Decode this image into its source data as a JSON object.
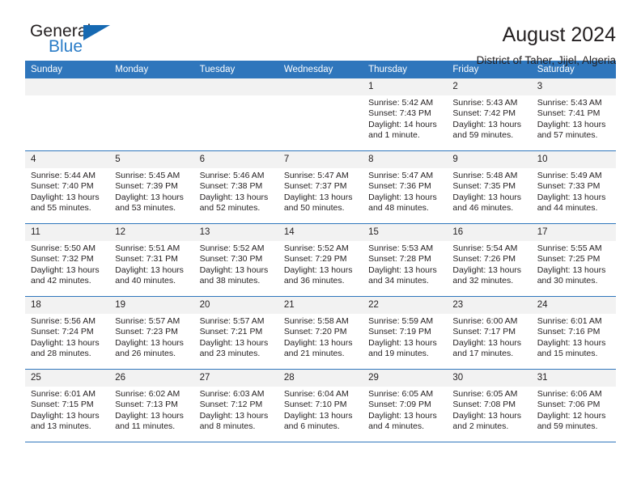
{
  "brand": {
    "name_part1": "General",
    "name_part2": "Blue",
    "triangle_color": "#1669b2",
    "blue_text_color": "#2a7cc7"
  },
  "header": {
    "title": "August 2024",
    "subtitle": "District of Taher, Jijel, Algeria"
  },
  "theme": {
    "header_bg": "#2f76bc",
    "daynum_bg": "#f2f2f2",
    "text": "#231f20"
  },
  "weekdays": [
    "Sunday",
    "Monday",
    "Tuesday",
    "Wednesday",
    "Thursday",
    "Friday",
    "Saturday"
  ],
  "labels": {
    "sunrise_prefix": "Sunrise:",
    "sunset_prefix": "Sunset:",
    "daylight_prefix": "Daylight:"
  },
  "weeks": [
    [
      {
        "day": "",
        "empty": true
      },
      {
        "day": "",
        "empty": true
      },
      {
        "day": "",
        "empty": true
      },
      {
        "day": "",
        "empty": true
      },
      {
        "day": "1",
        "sunrise": "Sunrise: 5:42 AM",
        "sunset": "Sunset: 7:43 PM",
        "daylight": "Daylight: 14 hours and 1 minute."
      },
      {
        "day": "2",
        "sunrise": "Sunrise: 5:43 AM",
        "sunset": "Sunset: 7:42 PM",
        "daylight": "Daylight: 13 hours and 59 minutes."
      },
      {
        "day": "3",
        "sunrise": "Sunrise: 5:43 AM",
        "sunset": "Sunset: 7:41 PM",
        "daylight": "Daylight: 13 hours and 57 minutes."
      }
    ],
    [
      {
        "day": "4",
        "sunrise": "Sunrise: 5:44 AM",
        "sunset": "Sunset: 7:40 PM",
        "daylight": "Daylight: 13 hours and 55 minutes."
      },
      {
        "day": "5",
        "sunrise": "Sunrise: 5:45 AM",
        "sunset": "Sunset: 7:39 PM",
        "daylight": "Daylight: 13 hours and 53 minutes."
      },
      {
        "day": "6",
        "sunrise": "Sunrise: 5:46 AM",
        "sunset": "Sunset: 7:38 PM",
        "daylight": "Daylight: 13 hours and 52 minutes."
      },
      {
        "day": "7",
        "sunrise": "Sunrise: 5:47 AM",
        "sunset": "Sunset: 7:37 PM",
        "daylight": "Daylight: 13 hours and 50 minutes."
      },
      {
        "day": "8",
        "sunrise": "Sunrise: 5:47 AM",
        "sunset": "Sunset: 7:36 PM",
        "daylight": "Daylight: 13 hours and 48 minutes."
      },
      {
        "day": "9",
        "sunrise": "Sunrise: 5:48 AM",
        "sunset": "Sunset: 7:35 PM",
        "daylight": "Daylight: 13 hours and 46 minutes."
      },
      {
        "day": "10",
        "sunrise": "Sunrise: 5:49 AM",
        "sunset": "Sunset: 7:33 PM",
        "daylight": "Daylight: 13 hours and 44 minutes."
      }
    ],
    [
      {
        "day": "11",
        "sunrise": "Sunrise: 5:50 AM",
        "sunset": "Sunset: 7:32 PM",
        "daylight": "Daylight: 13 hours and 42 minutes."
      },
      {
        "day": "12",
        "sunrise": "Sunrise: 5:51 AM",
        "sunset": "Sunset: 7:31 PM",
        "daylight": "Daylight: 13 hours and 40 minutes."
      },
      {
        "day": "13",
        "sunrise": "Sunrise: 5:52 AM",
        "sunset": "Sunset: 7:30 PM",
        "daylight": "Daylight: 13 hours and 38 minutes."
      },
      {
        "day": "14",
        "sunrise": "Sunrise: 5:52 AM",
        "sunset": "Sunset: 7:29 PM",
        "daylight": "Daylight: 13 hours and 36 minutes."
      },
      {
        "day": "15",
        "sunrise": "Sunrise: 5:53 AM",
        "sunset": "Sunset: 7:28 PM",
        "daylight": "Daylight: 13 hours and 34 minutes."
      },
      {
        "day": "16",
        "sunrise": "Sunrise: 5:54 AM",
        "sunset": "Sunset: 7:26 PM",
        "daylight": "Daylight: 13 hours and 32 minutes."
      },
      {
        "day": "17",
        "sunrise": "Sunrise: 5:55 AM",
        "sunset": "Sunset: 7:25 PM",
        "daylight": "Daylight: 13 hours and 30 minutes."
      }
    ],
    [
      {
        "day": "18",
        "sunrise": "Sunrise: 5:56 AM",
        "sunset": "Sunset: 7:24 PM",
        "daylight": "Daylight: 13 hours and 28 minutes."
      },
      {
        "day": "19",
        "sunrise": "Sunrise: 5:57 AM",
        "sunset": "Sunset: 7:23 PM",
        "daylight": "Daylight: 13 hours and 26 minutes."
      },
      {
        "day": "20",
        "sunrise": "Sunrise: 5:57 AM",
        "sunset": "Sunset: 7:21 PM",
        "daylight": "Daylight: 13 hours and 23 minutes."
      },
      {
        "day": "21",
        "sunrise": "Sunrise: 5:58 AM",
        "sunset": "Sunset: 7:20 PM",
        "daylight": "Daylight: 13 hours and 21 minutes."
      },
      {
        "day": "22",
        "sunrise": "Sunrise: 5:59 AM",
        "sunset": "Sunset: 7:19 PM",
        "daylight": "Daylight: 13 hours and 19 minutes."
      },
      {
        "day": "23",
        "sunrise": "Sunrise: 6:00 AM",
        "sunset": "Sunset: 7:17 PM",
        "daylight": "Daylight: 13 hours and 17 minutes."
      },
      {
        "day": "24",
        "sunrise": "Sunrise: 6:01 AM",
        "sunset": "Sunset: 7:16 PM",
        "daylight": "Daylight: 13 hours and 15 minutes."
      }
    ],
    [
      {
        "day": "25",
        "sunrise": "Sunrise: 6:01 AM",
        "sunset": "Sunset: 7:15 PM",
        "daylight": "Daylight: 13 hours and 13 minutes."
      },
      {
        "day": "26",
        "sunrise": "Sunrise: 6:02 AM",
        "sunset": "Sunset: 7:13 PM",
        "daylight": "Daylight: 13 hours and 11 minutes."
      },
      {
        "day": "27",
        "sunrise": "Sunrise: 6:03 AM",
        "sunset": "Sunset: 7:12 PM",
        "daylight": "Daylight: 13 hours and 8 minutes."
      },
      {
        "day": "28",
        "sunrise": "Sunrise: 6:04 AM",
        "sunset": "Sunset: 7:10 PM",
        "daylight": "Daylight: 13 hours and 6 minutes."
      },
      {
        "day": "29",
        "sunrise": "Sunrise: 6:05 AM",
        "sunset": "Sunset: 7:09 PM",
        "daylight": "Daylight: 13 hours and 4 minutes."
      },
      {
        "day": "30",
        "sunrise": "Sunrise: 6:05 AM",
        "sunset": "Sunset: 7:08 PM",
        "daylight": "Daylight: 13 hours and 2 minutes."
      },
      {
        "day": "31",
        "sunrise": "Sunrise: 6:06 AM",
        "sunset": "Sunset: 7:06 PM",
        "daylight": "Daylight: 12 hours and 59 minutes."
      }
    ]
  ]
}
